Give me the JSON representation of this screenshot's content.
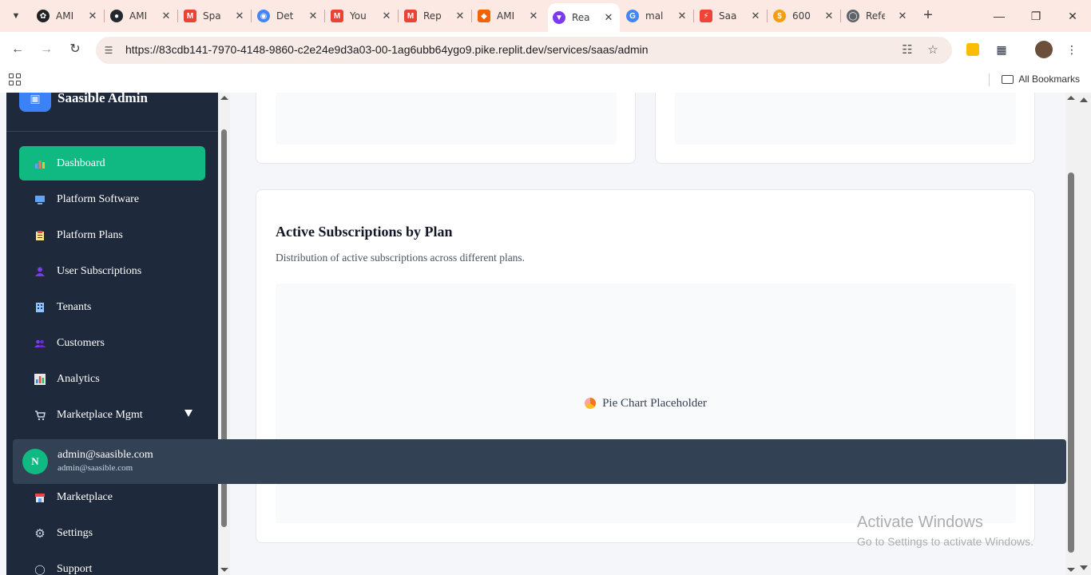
{
  "browser": {
    "tabs": [
      {
        "title": "AMI",
        "favicon_color": "#202124",
        "favicon_glyph": "openai-icon"
      },
      {
        "title": "AMI",
        "favicon_color": "#24292f",
        "favicon_glyph": "github-icon"
      },
      {
        "title": "Spa",
        "favicon_color": "#ea4335",
        "favicon_glyph": "gmail-icon"
      },
      {
        "title": "Det",
        "favicon_color": "#4285f4",
        "favicon_glyph": "chrome-icon"
      },
      {
        "title": "You",
        "favicon_color": "#ea4335",
        "favicon_glyph": "gmail-icon"
      },
      {
        "title": "Rep",
        "favicon_color": "#ea4335",
        "favicon_glyph": "gmail-icon"
      },
      {
        "title": "AMI",
        "favicon_color": "#f26207",
        "favicon_glyph": "replit-icon"
      },
      {
        "title": "Rea",
        "favicon_color": "#7c3aed",
        "favicon_glyph": "vite-icon",
        "active": true
      },
      {
        "title": "mal",
        "favicon_color": "#4285f4",
        "favicon_glyph": "google-icon"
      },
      {
        "title": "Saa",
        "favicon_color": "#f04438",
        "favicon_glyph": "bolt-icon"
      },
      {
        "title": "600",
        "favicon_color": "#f59e0b",
        "favicon_glyph": "coin-icon"
      },
      {
        "title": "Refe",
        "favicon_color": "#5f6368",
        "favicon_glyph": "globe-icon"
      }
    ],
    "url": "https://83cdb141-7970-4148-9860-c2e24e9d3a03-00-1ag6ubb64ygo9.pike.replit.dev/services/saas/admin",
    "bookmarks_label": "All Bookmarks"
  },
  "sidebar": {
    "brand": "Saasible Admin",
    "items": [
      {
        "label": "Dashboard",
        "icon": "chart-icon",
        "active": true
      },
      {
        "label": "Platform Software",
        "icon": "monitor-icon"
      },
      {
        "label": "Platform Plans",
        "icon": "clipboard-icon"
      },
      {
        "label": "User Subscriptions",
        "icon": "user-icon"
      },
      {
        "label": "Tenants",
        "icon": "building-icon"
      },
      {
        "label": "Customers",
        "icon": "users-icon"
      },
      {
        "label": "Analytics",
        "icon": "bar-chart-icon"
      },
      {
        "label": "Marketplace Mgmt",
        "icon": "cart-icon",
        "expandable": true
      },
      {
        "label": "Marketplace",
        "icon": "store-icon"
      },
      {
        "label": "Settings",
        "icon": "gear-icon"
      },
      {
        "label": "Support",
        "icon": "help-icon"
      }
    ]
  },
  "user_menu": {
    "initial": "N",
    "name": "admin@saasible.com",
    "email": "admin@saasible.com"
  },
  "main": {
    "subscriptions_card": {
      "title": "Active Subscriptions by Plan",
      "subtitle": "Distribution of active subscriptions across different plans.",
      "placeholder": "Pie Chart Placeholder"
    }
  },
  "watermark": {
    "line1": "Activate Windows",
    "line2": "Go to Settings to activate Windows."
  }
}
